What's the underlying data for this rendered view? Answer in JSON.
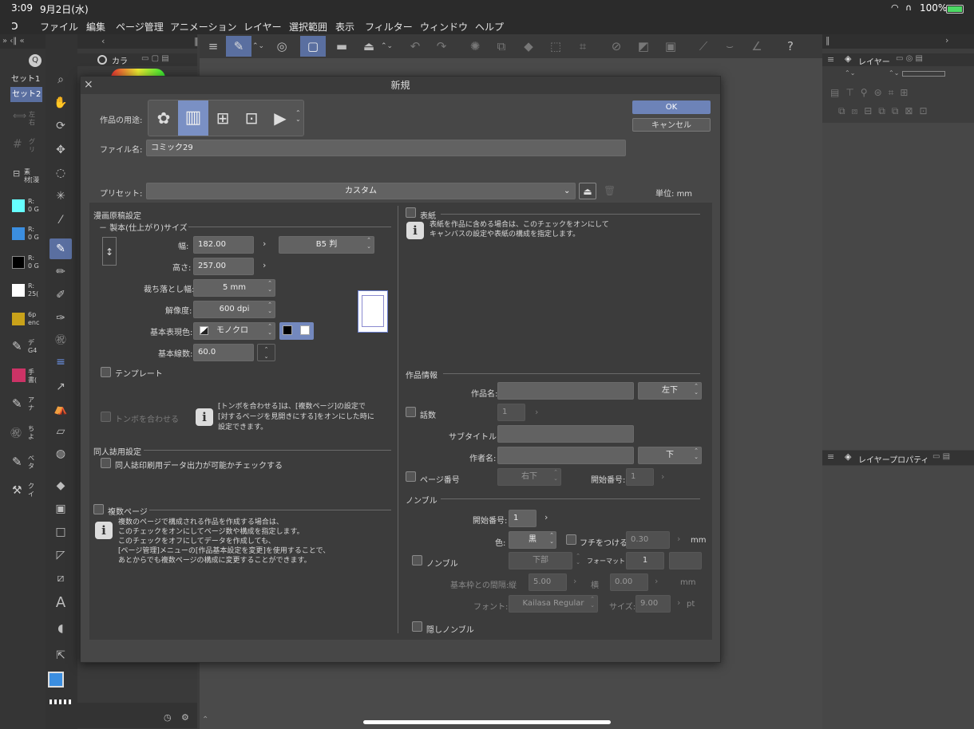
{
  "status": {
    "time": "3:09",
    "date": "9月2日(水)",
    "battery": "100%"
  },
  "menu": [
    "ファイル",
    "編集",
    "ページ管理",
    "アニメーション",
    "レイヤー",
    "選択範囲",
    "表示",
    "フィルター",
    "ウィンドウ",
    "ヘルプ"
  ],
  "left": {
    "set1": "セット1",
    "set2": "セット2",
    "items": [
      {
        "a": "左",
        "b": "右"
      },
      {
        "a": "グ",
        "b": "リ"
      },
      {
        "a": "素",
        "b": "材[漫"
      },
      {
        "a": "R:",
        "b": "0 G"
      },
      {
        "a": "R:",
        "b": "0 G"
      },
      {
        "a": "R:",
        "b": "0 G"
      },
      {
        "a": "R:",
        "b": "25("
      },
      {
        "a": "6p",
        "b": "enc"
      },
      {
        "a": "デ",
        "b": "G4"
      },
      {
        "a": "手",
        "b": "書("
      },
      {
        "a": "ア",
        "b": "ナ"
      },
      {
        "a": "ち",
        "b": "よ"
      },
      {
        "a": "べ",
        "b": "タ"
      },
      {
        "a": "ク",
        "b": "イ"
      }
    ]
  },
  "color_panel": {
    "tab": "カラ"
  },
  "right_panel": {
    "layer_tab": "レイヤー",
    "layer_prop_tab": "レイヤープロパティ"
  },
  "dialog": {
    "title": "新規",
    "ok": "OK",
    "cancel": "キャンセル",
    "usage_label": "作品の用途:",
    "filename_label": "ファイル名:",
    "filename_value": "コミック29",
    "preset_label": "プリセット:",
    "preset_value": "カスタム",
    "unit_label": "単位:",
    "unit_value": "mm",
    "manga": {
      "section": "漫画原稿設定",
      "bind_section": "製本(仕上がり)サイズ",
      "width_label": "幅:",
      "width_value": "182.00",
      "height_label": "高さ:",
      "height_value": "257.00",
      "size_preset": "B5 判",
      "bleed_label": "裁ち落とし幅:",
      "bleed_value": "5 mm",
      "resolution_label": "解像度:",
      "resolution_value": "600 dpi",
      "color_label": "基本表現色:",
      "color_value": "モノクロ",
      "lines_label": "基本線数:",
      "lines_value": "60.0",
      "template": "テンプレート",
      "tombo": "トンボを合わせる",
      "tombo_info": [
        "[トンボを合わせる]は、[複数ページ]の設定で",
        "[対するページを見開きにする]をオンにした時に",
        "設定できます。"
      ]
    },
    "doujin": {
      "section": "同人誌用設定",
      "check": "同人誌印刷用データ出力が可能かチェックする"
    },
    "multipage": {
      "label": "複数ページ",
      "info": [
        "複数のページで構成される作品を作成する場合は、",
        "このチェックをオンにしてページ数や構成を指定します。",
        "このチェックをオフにしてデータを作成しても、",
        "[ページ管理]メニューの[作品基本設定を変更]を使用することで、",
        "あとからでも複数ページの構成に変更することができます。"
      ]
    },
    "cover": {
      "label": "表紙",
      "info": [
        "表紙を作品に含める場合は、このチェックをオンにして",
        "キャンバスの設定や表紙の構成を指定します。"
      ]
    },
    "work": {
      "section": "作品情報",
      "title_label": "作品名:",
      "title_pos": "左下",
      "episode_label": "話数",
      "episode_value": "1",
      "subtitle_label": "サブタイトル:",
      "author_label": "作者名:",
      "author_pos": "下",
      "pagenum_label": "ページ番号",
      "pagenum_pos": "右下",
      "start_label": "開始番号:",
      "start_value": "1"
    },
    "nombre": {
      "section": "ノンブル",
      "start_label": "開始番号:",
      "start_value": "1",
      "color_label": "色:",
      "color_value": "黒",
      "outline_label": "フチをつける",
      "outline_value": "0.30",
      "mm": "mm",
      "nombre_label": "ノンブル",
      "pos_value": "下部",
      "format_label": "フォーマット",
      "format_value": "1",
      "gap_label": "基本枠との間隔:",
      "vert_label": "縦",
      "vert_value": "5.00",
      "horiz_label": "横",
      "horiz_value": "0.00",
      "mm2": "mm",
      "font_label": "フォント:",
      "font_value": "Kailasa Regular",
      "size_label": "サイズ:",
      "size_value": "9.00",
      "pt": "pt",
      "hidden": "隠しノンブル"
    }
  }
}
